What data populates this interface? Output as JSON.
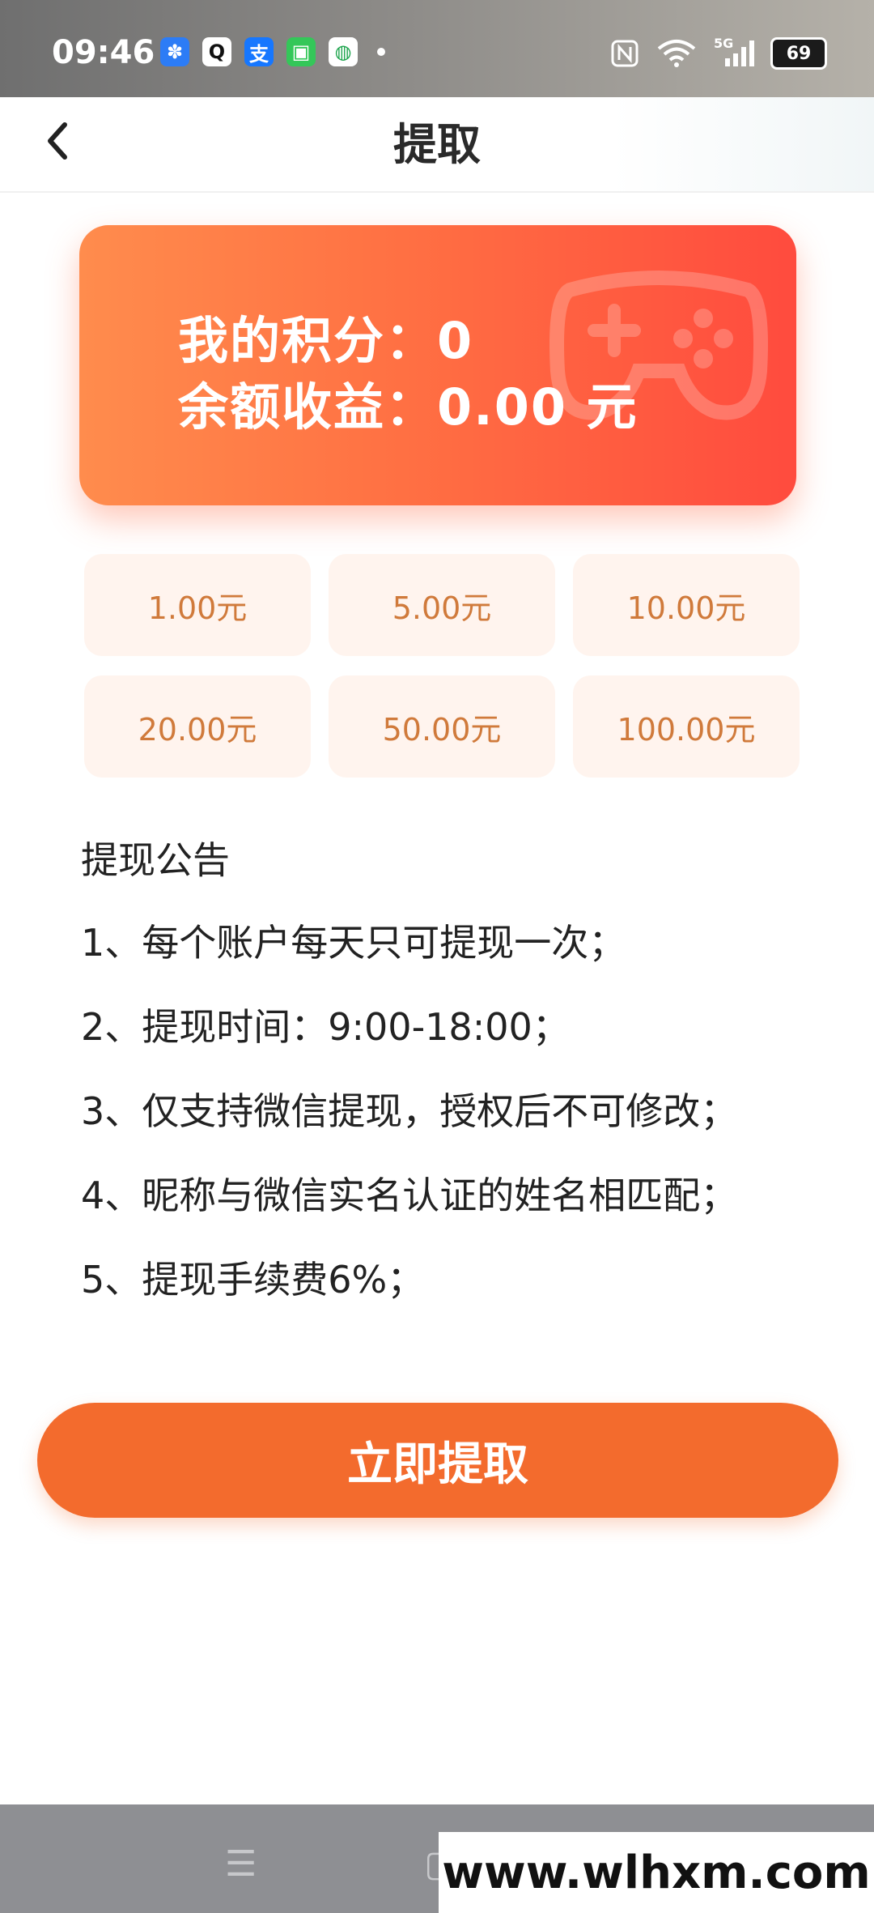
{
  "status_bar": {
    "time": "09:46",
    "battery": "69",
    "app_icons": [
      {
        "name": "pinwheel-app-icon",
        "glyph": "✽",
        "color": "#2c7cf6"
      },
      {
        "name": "qq-icon",
        "glyph": "🐧",
        "color": "#ffffff"
      },
      {
        "name": "alipay-icon",
        "glyph": "支",
        "color": "#1677ff"
      },
      {
        "name": "messages-icon",
        "glyph": "▣",
        "color": "#34c759"
      },
      {
        "name": "china-mobile-icon",
        "glyph": "◍",
        "color": "#ffffff"
      }
    ],
    "network": "5G"
  },
  "header": {
    "title": "提取"
  },
  "card": {
    "points_text": "我的积分：0",
    "balance_text": "余额收益：0.00 元"
  },
  "amount_options": [
    "1.00元",
    "5.00元",
    "10.00元",
    "20.00元",
    "50.00元",
    "100.00元"
  ],
  "notice": {
    "title": "提现公告",
    "rules": [
      "1、每个账户每天只可提现一次；",
      "2、提现时间：9:00-18:00；",
      "3、仅支持微信提现，授权后不可修改；",
      "4、昵称与微信实名认证的姓名相匹配；",
      "5、提现手续费6%；"
    ]
  },
  "action": {
    "withdraw_label": "立即提取"
  },
  "watermark": "www.wlhxm.com",
  "colors": {
    "accent": "#f36b2d",
    "card_gradient_start": "#ff8c4d",
    "card_gradient_end": "#ff4b3e",
    "amount_bg": "#fff4ee",
    "amount_text": "#d07a3b"
  }
}
